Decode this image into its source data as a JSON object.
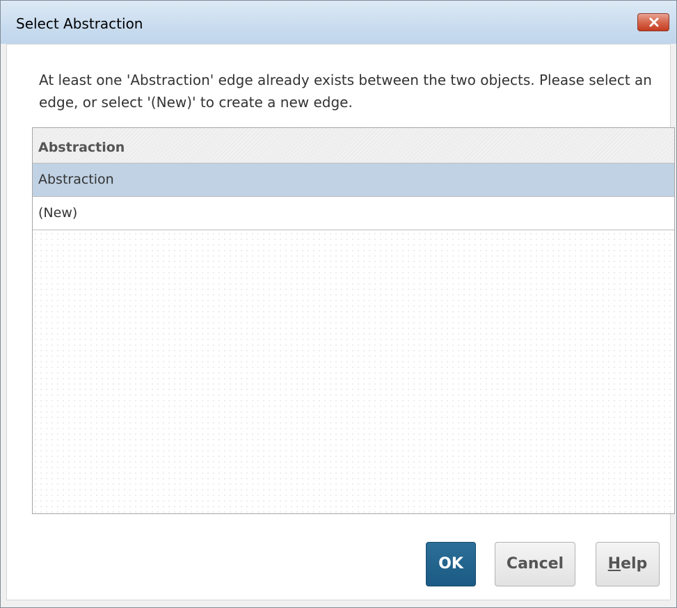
{
  "window": {
    "title": "Select Abstraction",
    "close_icon": "close-icon"
  },
  "message": "At least one 'Abstraction' edge already exists between the two objects. Please select an edge, or select '(New)' to create a new edge.",
  "table": {
    "column_header": "Abstraction",
    "rows": [
      {
        "label": "Abstraction",
        "selected": true
      },
      {
        "label": "(New)",
        "selected": false
      }
    ]
  },
  "buttons": {
    "ok": "OK",
    "cancel": "Cancel",
    "help": "Help"
  },
  "colors": {
    "primary_button": "#1f6088",
    "selected_row": "#c0d2e4",
    "close_button": "#d6674c"
  }
}
